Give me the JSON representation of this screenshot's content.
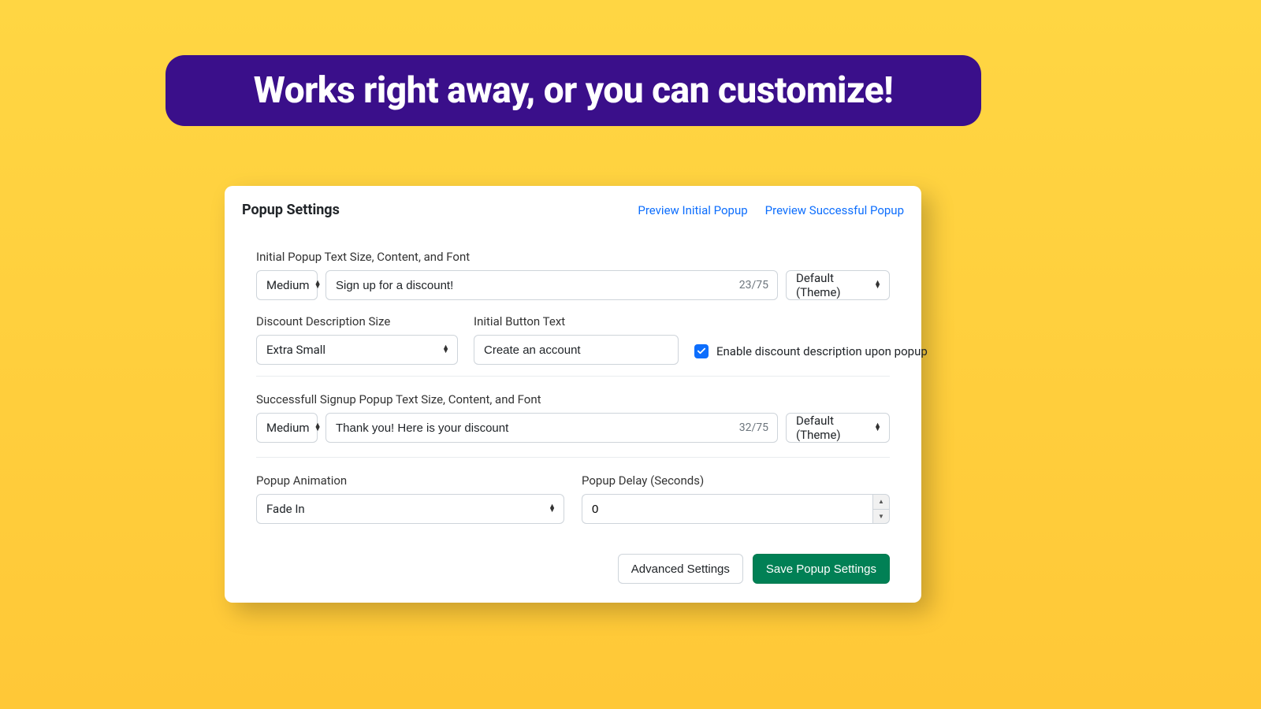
{
  "banner": "Works right away, or you can customize!",
  "card": {
    "title": "Popup Settings",
    "links": {
      "preview_initial": "Preview Initial Popup",
      "preview_success": "Preview Successful Popup"
    }
  },
  "initial": {
    "group_label": "Initial Popup Text Size, Content, and Font",
    "size": "Medium",
    "text": "Sign up for a discount!",
    "counter": "23/75",
    "font": "Default (Theme)"
  },
  "desc": {
    "label": "Discount Description Size",
    "size": "Extra Small"
  },
  "init_button": {
    "label": "Initial Button Text",
    "text": "Create an account"
  },
  "enable_desc": {
    "checked": true,
    "label": "Enable discount description upon popup"
  },
  "success": {
    "group_label": "Successfull Signup Popup Text Size, Content, and Font",
    "size": "Medium",
    "text": "Thank you! Here is your discount",
    "counter": "32/75",
    "font": "Default (Theme)"
  },
  "animation": {
    "label": "Popup Animation",
    "value": "Fade In"
  },
  "delay": {
    "label": "Popup Delay (Seconds)",
    "value": "0"
  },
  "footer": {
    "advanced": "Advanced Settings",
    "save": "Save Popup Settings"
  }
}
